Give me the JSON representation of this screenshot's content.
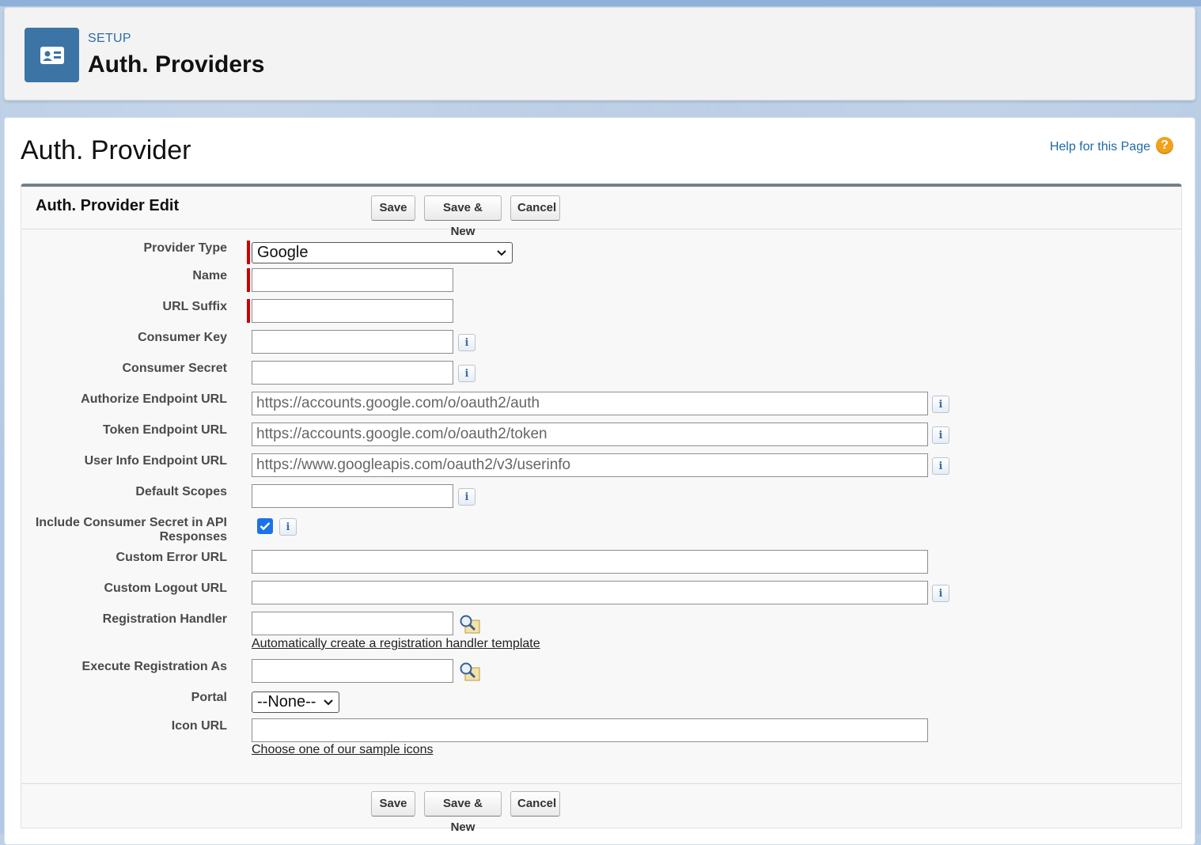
{
  "header": {
    "eyebrow": "SETUP",
    "title": "Auth. Providers",
    "icon": "id-card-icon"
  },
  "page": {
    "title": "Auth. Provider",
    "help_link": "Help for this Page",
    "help_icon": "?"
  },
  "edit": {
    "title": "Auth. Provider Edit",
    "buttons": {
      "save": "Save",
      "save_new": "Save & New",
      "cancel": "Cancel"
    }
  },
  "fields": {
    "provider_type": {
      "label": "Provider Type",
      "value": "Google"
    },
    "name": {
      "label": "Name",
      "value": ""
    },
    "url_suffix": {
      "label": "URL Suffix",
      "value": ""
    },
    "consumer_key": {
      "label": "Consumer Key",
      "value": ""
    },
    "consumer_secret": {
      "label": "Consumer Secret",
      "value": ""
    },
    "authorize_endpoint": {
      "label": "Authorize Endpoint URL",
      "value": "https://accounts.google.com/o/oauth2/auth"
    },
    "token_endpoint": {
      "label": "Token Endpoint URL",
      "value": "https://accounts.google.com/o/oauth2/token"
    },
    "user_info_endpoint": {
      "label": "User Info Endpoint URL",
      "value": "https://www.googleapis.com/oauth2/v3/userinfo"
    },
    "default_scopes": {
      "label": "Default Scopes",
      "value": ""
    },
    "include_secret": {
      "label_line1": "Include Consumer Secret in API",
      "label_line2": "Responses",
      "checked": true
    },
    "custom_error_url": {
      "label": "Custom Error URL",
      "value": ""
    },
    "custom_logout_url": {
      "label": "Custom Logout URL",
      "value": ""
    },
    "registration_handler": {
      "label": "Registration Handler",
      "value": "",
      "link": "Automatically create a registration handler template"
    },
    "execute_registration_as": {
      "label": "Execute Registration As",
      "value": ""
    },
    "portal": {
      "label": "Portal",
      "value": "--None--"
    },
    "icon_url": {
      "label": "Icon URL",
      "value": "",
      "link": "Choose one of our sample icons"
    }
  },
  "info_icon_glyph": "i",
  "colors": {
    "required": "#cc0000",
    "accent": "#3c74a6",
    "help": "#f2a21a",
    "checkbox": "#1a73e8"
  }
}
